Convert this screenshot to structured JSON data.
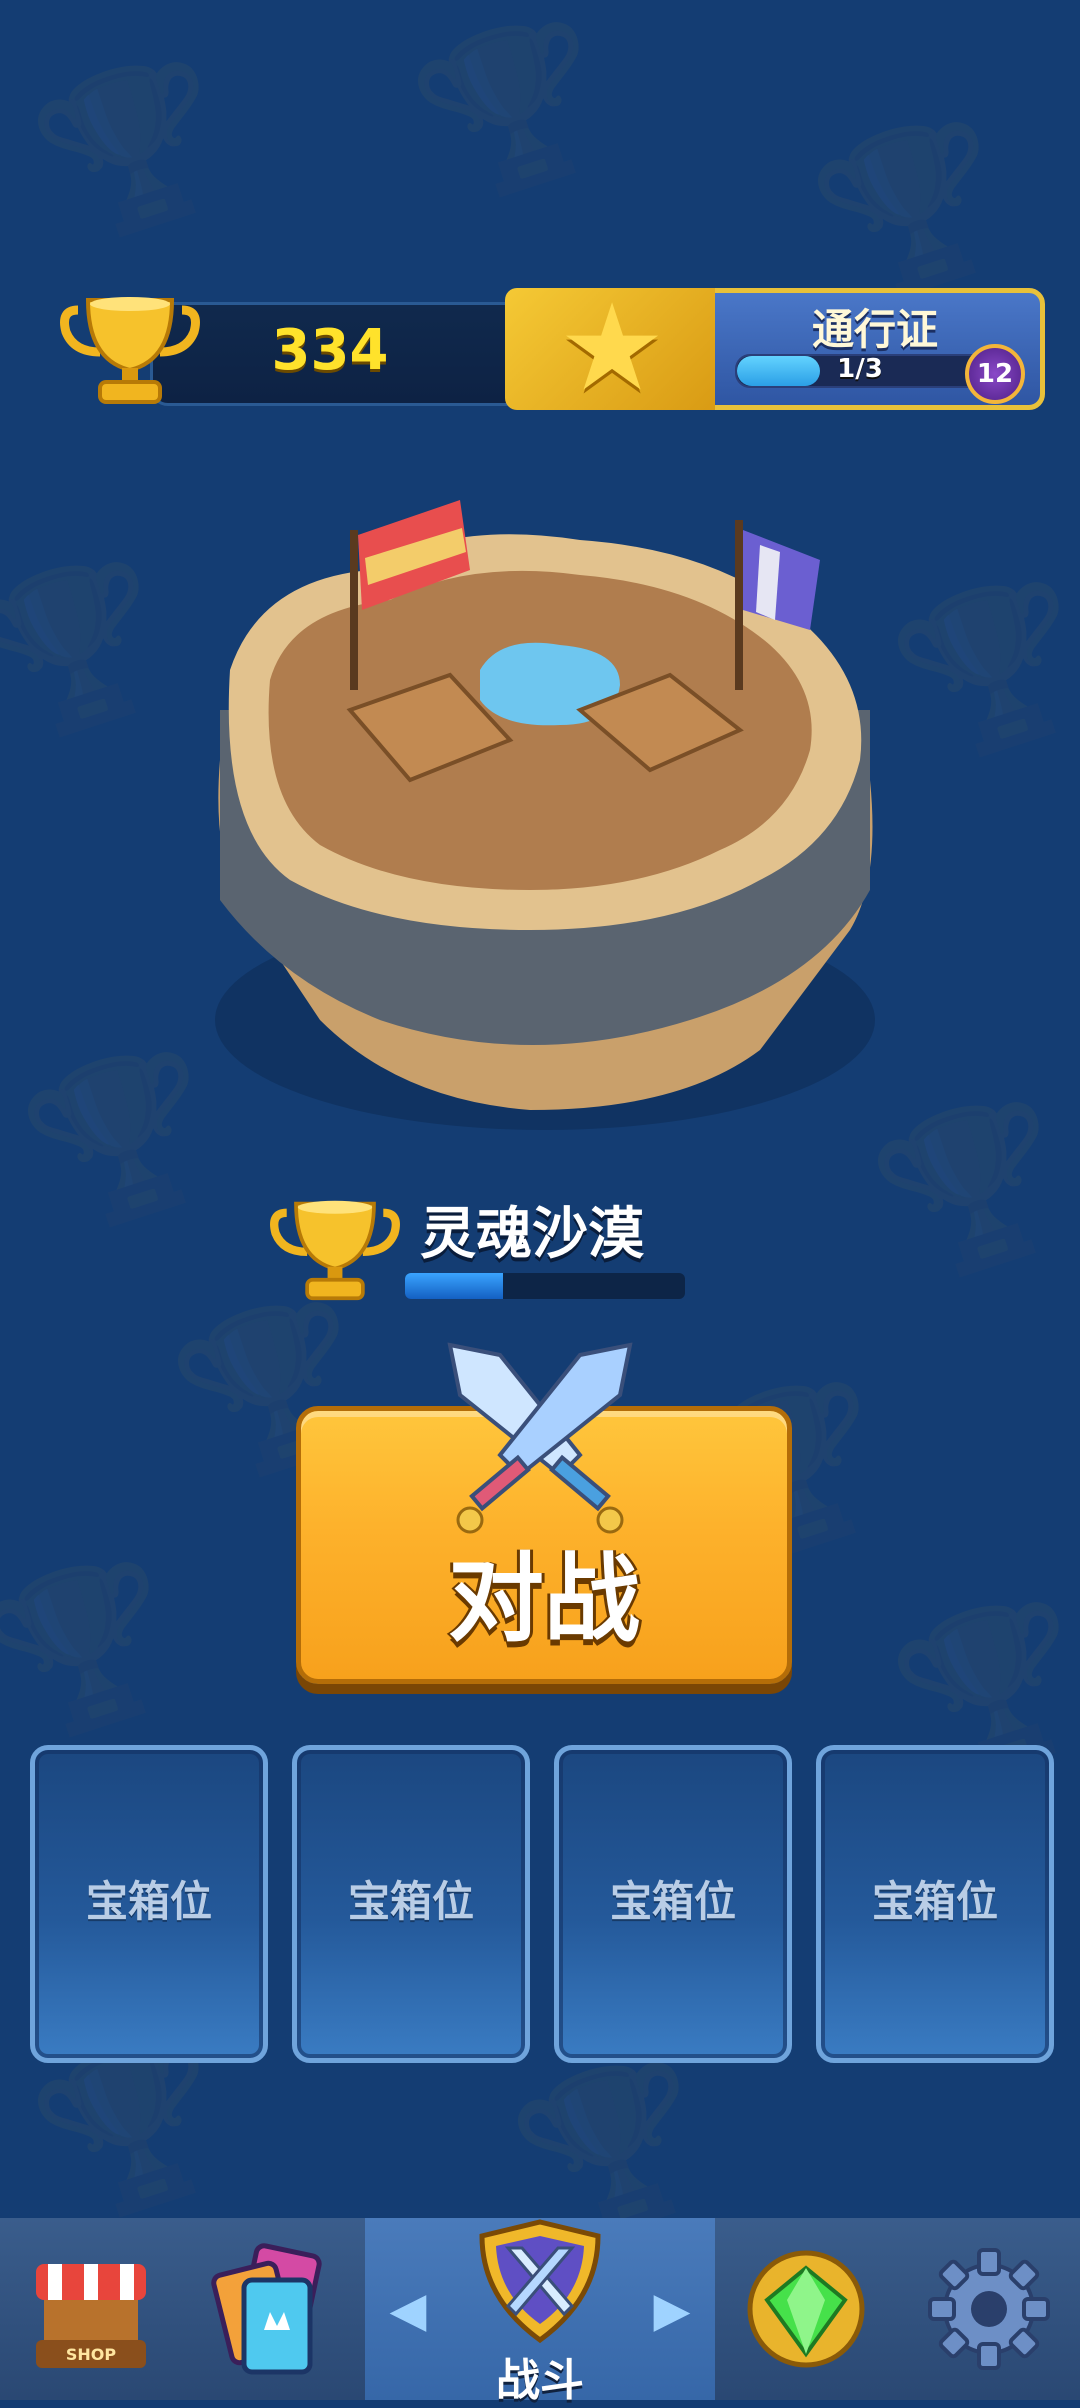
{
  "header": {
    "trophies": "334",
    "pass": {
      "title": "通行证",
      "progress_text": "1/3",
      "progress": 0.333,
      "level": "12"
    }
  },
  "arena": {
    "name": "灵魂沙漠",
    "progress": 0.35
  },
  "battle_button": {
    "label": "对战"
  },
  "chest_slots": [
    {
      "label": "宝箱位"
    },
    {
      "label": "宝箱位"
    },
    {
      "label": "宝箱位"
    },
    {
      "label": "宝箱位"
    }
  ],
  "bottom_nav": {
    "shop_sign": "SHOP",
    "active_tab_label": "战斗",
    "tabs": [
      "shop-icon",
      "cards-icon",
      "battle-icon",
      "gem-icon",
      "settings-icon"
    ]
  },
  "colors": {
    "background": "#143d73",
    "accent_gold": "#fdb12b",
    "trophy_text": "#ffe22b"
  }
}
